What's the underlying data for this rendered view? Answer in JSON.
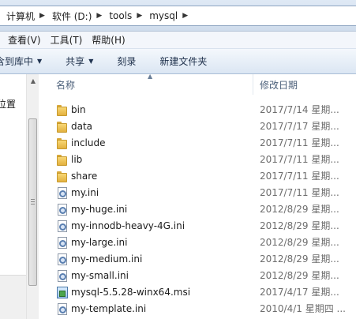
{
  "address": {
    "crumbs": [
      "计算机",
      "软件 (D:)",
      "tools",
      "mysql"
    ]
  },
  "menubar": {
    "items": [
      "查看(V)",
      "工具(T)",
      "帮助(H)"
    ]
  },
  "toolbar": {
    "include_library": "含到库中",
    "share": "共享",
    "burn": "刻录",
    "new_folder": "新建文件夹"
  },
  "navpane": {
    "label": "位置"
  },
  "columns": {
    "name": "名称",
    "date": "修改日期"
  },
  "files": [
    {
      "name": "bin",
      "date": "2017/7/14 星期...",
      "icon": "folder-icon"
    },
    {
      "name": "data",
      "date": "2017/7/17 星期...",
      "icon": "folder-icon"
    },
    {
      "name": "include",
      "date": "2017/7/11 星期...",
      "icon": "folder-icon"
    },
    {
      "name": "lib",
      "date": "2017/7/11 星期...",
      "icon": "folder-icon"
    },
    {
      "name": "share",
      "date": "2017/7/11 星期...",
      "icon": "folder-icon"
    },
    {
      "name": "my.ini",
      "date": "2017/7/11 星期...",
      "icon": "ini-icon"
    },
    {
      "name": "my-huge.ini",
      "date": "2012/8/29 星期...",
      "icon": "ini-icon"
    },
    {
      "name": "my-innodb-heavy-4G.ini",
      "date": "2012/8/29 星期...",
      "icon": "ini-icon"
    },
    {
      "name": "my-large.ini",
      "date": "2012/8/29 星期...",
      "icon": "ini-icon"
    },
    {
      "name": "my-medium.ini",
      "date": "2012/8/29 星期...",
      "icon": "ini-icon"
    },
    {
      "name": "my-small.ini",
      "date": "2012/8/29 星期...",
      "icon": "ini-icon"
    },
    {
      "name": "mysql-5.5.28-winx64.msi",
      "date": "2017/4/17 星期...",
      "icon": "msi-icon"
    },
    {
      "name": "my-template.ini",
      "date": "2010/4/1 星期四 ...",
      "icon": "ini-icon"
    }
  ]
}
